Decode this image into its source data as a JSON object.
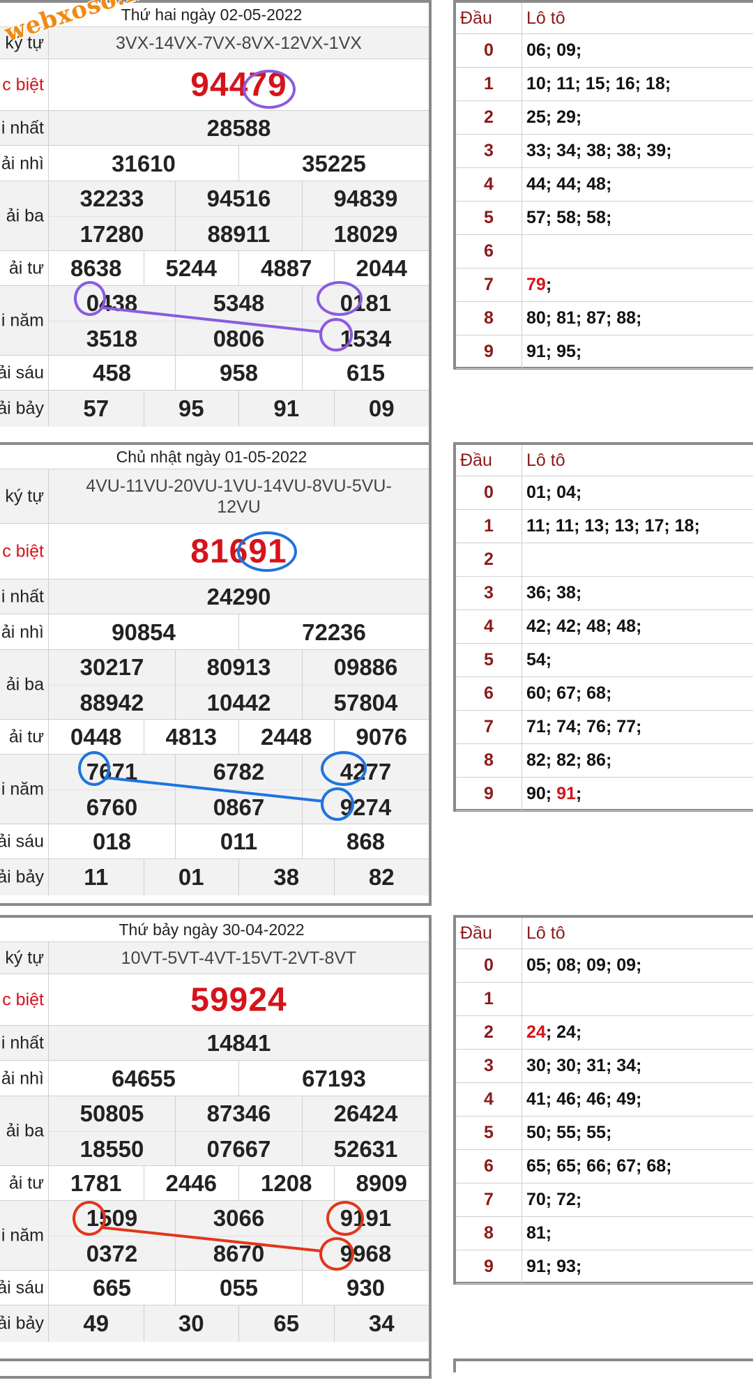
{
  "labels": {
    "serial": "ký tự",
    "special": "c biệt",
    "first": "i nhất",
    "second": "ải nhì",
    "third": "ải ba",
    "fourth": "ải tư",
    "fifth": "i năm",
    "sixth": "ải sáu",
    "seventh": "ải bảy",
    "loto_head": "Đầu",
    "loto_val": "Lô tô"
  },
  "watermark": "webxoso.net",
  "colors": {
    "purple": "#8a5be0",
    "blue": "#1f74e0",
    "red": "#e2361a",
    "accent_red": "#d4141a",
    "dark_red": "#8b1a1a"
  },
  "draws": [
    {
      "date": "Thứ hai ngày 02-05-2022",
      "serial": "3VX-14VX-7VX-8VX-12VX-1VX",
      "special": "94479",
      "first": "28588",
      "second": [
        "31610",
        "35225"
      ],
      "third": [
        "32233",
        "94516",
        "94839",
        "17280",
        "88911",
        "18029"
      ],
      "fourth": [
        "8638",
        "5244",
        "4887",
        "2044"
      ],
      "fifth": [
        "0438",
        "5348",
        "0181",
        "3518",
        "0806",
        "1534"
      ],
      "sixth": [
        "458",
        "958",
        "615"
      ],
      "seventh": [
        "57",
        "95",
        "91",
        "09"
      ],
      "loto": [
        {
          "d": "0",
          "v": "06; 09;"
        },
        {
          "d": "1",
          "v": "10; 11; 15; 16; 18;"
        },
        {
          "d": "2",
          "v": "25; 29;"
        },
        {
          "d": "3",
          "v": "33; 34; 38; 38; 39;"
        },
        {
          "d": "4",
          "v": "44; 44; 48;"
        },
        {
          "d": "5",
          "v": "57; 58; 58;"
        },
        {
          "d": "6",
          "v": ""
        },
        {
          "d": "7",
          "hl": "79",
          "v": ";"
        },
        {
          "d": "8",
          "v": "80; 81; 87; 88;"
        },
        {
          "d": "9",
          "v": "91; 95;"
        }
      ]
    },
    {
      "date": "Chủ nhật ngày 01-05-2022",
      "serial": "4VU-11VU-20VU-1VU-14VU-8VU-5VU-12VU",
      "special": "81691",
      "first": "24290",
      "second": [
        "90854",
        "72236"
      ],
      "third": [
        "30217",
        "80913",
        "09886",
        "88942",
        "10442",
        "57804"
      ],
      "fourth": [
        "0448",
        "4813",
        "2448",
        "9076"
      ],
      "fifth": [
        "7671",
        "6782",
        "4277",
        "6760",
        "0867",
        "9274"
      ],
      "sixth": [
        "018",
        "011",
        "868"
      ],
      "seventh": [
        "11",
        "01",
        "38",
        "82"
      ],
      "loto": [
        {
          "d": "0",
          "v": "01; 04;"
        },
        {
          "d": "1",
          "v": "11; 11; 13; 13; 17; 18;"
        },
        {
          "d": "2",
          "v": ""
        },
        {
          "d": "3",
          "v": "36; 38;"
        },
        {
          "d": "4",
          "v": "42; 42; 48; 48;"
        },
        {
          "d": "5",
          "v": "54;"
        },
        {
          "d": "6",
          "v": "60; 67; 68;"
        },
        {
          "d": "7",
          "v": "71; 74; 76; 77;"
        },
        {
          "d": "8",
          "v": "82; 82; 86;"
        },
        {
          "d": "9",
          "v": "90; ",
          "hl": "91",
          "tail": ";"
        }
      ]
    },
    {
      "date": "Thứ bảy ngày 30-04-2022",
      "serial": "10VT-5VT-4VT-15VT-2VT-8VT",
      "special": "59924",
      "first": "14841",
      "second": [
        "64655",
        "67193"
      ],
      "third": [
        "50805",
        "87346",
        "26424",
        "18550",
        "07667",
        "52631"
      ],
      "fourth": [
        "1781",
        "2446",
        "1208",
        "8909"
      ],
      "fifth": [
        "1509",
        "3066",
        "9191",
        "0372",
        "8670",
        "9968"
      ],
      "sixth": [
        "665",
        "055",
        "930"
      ],
      "seventh": [
        "49",
        "30",
        "65",
        "34"
      ],
      "loto": [
        {
          "d": "0",
          "v": "05; 08; 09; 09;"
        },
        {
          "d": "1",
          "v": ""
        },
        {
          "d": "2",
          "hl": "24",
          "v": "; 24;"
        },
        {
          "d": "3",
          "v": "30; 30; 31; 34;"
        },
        {
          "d": "4",
          "v": "41; 46; 46; 49;"
        },
        {
          "d": "5",
          "v": "50; 55; 55;"
        },
        {
          "d": "6",
          "v": "65; 65; 66; 67; 68;"
        },
        {
          "d": "7",
          "v": "70; 72;"
        },
        {
          "d": "8",
          "v": "81;"
        },
        {
          "d": "9",
          "v": "91; 93;"
        }
      ]
    }
  ]
}
